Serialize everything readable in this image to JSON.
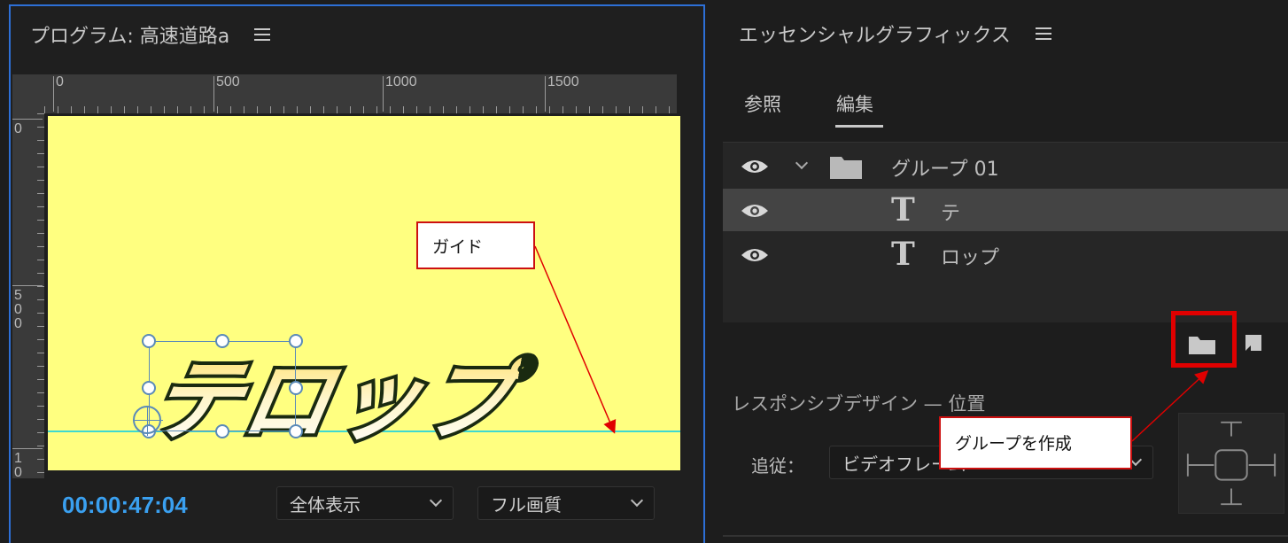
{
  "program_monitor": {
    "title": "プログラム: 高速道路a",
    "ruler_h_labels": [
      "0",
      "500",
      "1000",
      "1500"
    ],
    "ruler_v_labels": [
      "0",
      "500",
      "10"
    ],
    "telop_text": "テロップ",
    "timecode": "00:00:47:04",
    "zoom_dropdown": "全体表示",
    "quality_dropdown": "フル画質",
    "canvas_color": "#ffff80",
    "guide_color": "#3dd9d0",
    "accent_color": "#2d6fd6"
  },
  "essential_graphics": {
    "title": "エッセンシャルグラフィックス",
    "tabs": [
      {
        "label": "参照",
        "active": false
      },
      {
        "label": "編集",
        "active": true
      }
    ],
    "layers": [
      {
        "label": "グループ 01",
        "type": "group",
        "icon": "folder-icon",
        "expanded": true,
        "selected": false
      },
      {
        "label": "テ",
        "type": "text",
        "icon": "text-t-icon",
        "selected": true
      },
      {
        "label": "ロップ",
        "type": "text",
        "icon": "text-t-icon",
        "selected": false
      }
    ],
    "responsive_design_label": "レスポンシブデザイン — 位置",
    "follow_label": "追従：",
    "follow_dropdown": "ビデオフレーム"
  },
  "annotations": {
    "guide_callout": "ガイド",
    "group_callout": "グループを作成",
    "highlight_color": "#e00000"
  }
}
